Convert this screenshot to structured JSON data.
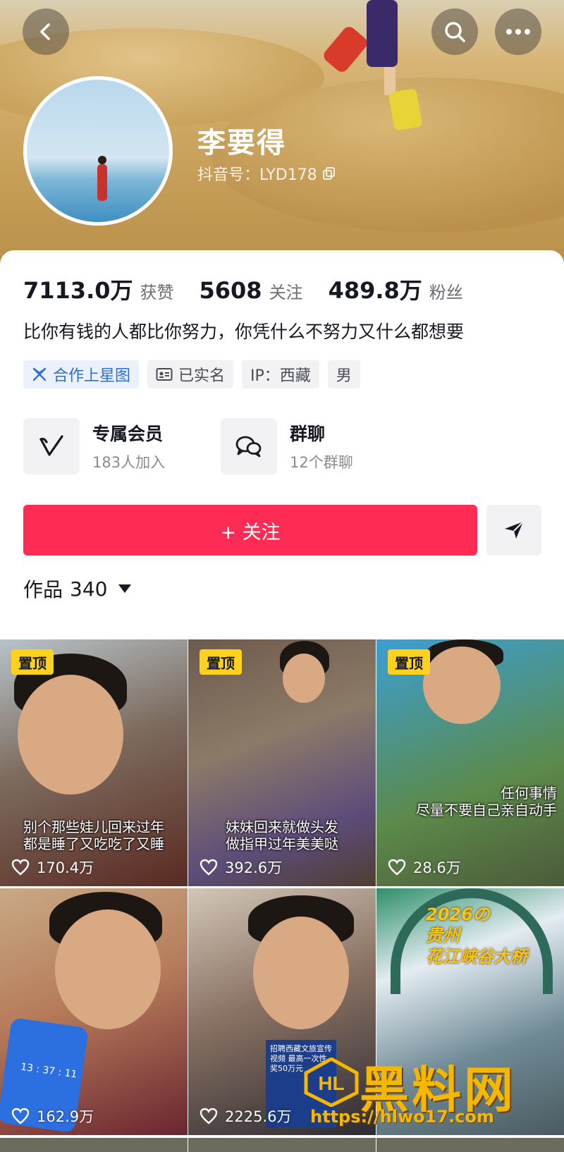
{
  "header": {
    "name": "李要得",
    "douyin_id": "抖音号：LYD178"
  },
  "stats": [
    {
      "value": "7113.0万",
      "label": "获赞"
    },
    {
      "value": "5608",
      "label": "关注"
    },
    {
      "value": "489.8万",
      "label": "粉丝"
    }
  ],
  "bio": "比你有钱的人都比你努力，你凭什么不努力又什么都想要",
  "tags": [
    {
      "label": "合作上星图",
      "icon": "star-map-icon"
    },
    {
      "label": "已实名",
      "icon": "id-card-icon"
    },
    {
      "label": "IP：西藏"
    },
    {
      "label": "男"
    }
  ],
  "features": [
    {
      "title": "专属会员",
      "sub": "183人加入",
      "icon": "vip-v-icon"
    },
    {
      "title": "群聊",
      "sub": "12个群聊",
      "icon": "chat-bubbles-icon"
    }
  ],
  "follow_label": "+ 关注",
  "works": {
    "label": "作品",
    "count": "340"
  },
  "videos": [
    {
      "pinned": "置顶",
      "caption_lines": [
        "别个那些娃儿回来过年",
        "都是睡了又吃吃了又睡"
      ],
      "likes": "170.4万"
    },
    {
      "pinned": "置顶",
      "caption_lines": [
        "妹妹回来就做头发",
        "做指甲过年美美哒"
      ],
      "likes": "392.6万"
    },
    {
      "pinned": "置顶",
      "caption_lines": [
        "任何事情",
        "尽量不要自己亲自动手"
      ],
      "likes": "28.6万"
    },
    {
      "caption_lines": [],
      "likes": "162.9万",
      "overlay": "13 : 37 : 11"
    },
    {
      "caption_lines": [],
      "likes": "2225.6万",
      "overlay": "招聘西藏文旅宣传视频 最高一次性奖50万元"
    },
    {
      "caption_lines": [],
      "likes": "",
      "title_lines": [
        "2026の",
        "贵州",
        "花江峡谷大桥"
      ]
    }
  ],
  "watermark": {
    "big": "黑料网",
    "url": "https://hlwo17.com"
  },
  "colors": {
    "primary": "#fe2c55",
    "tag_blue": "#2b6fd6",
    "pin": "#fcd21e"
  }
}
